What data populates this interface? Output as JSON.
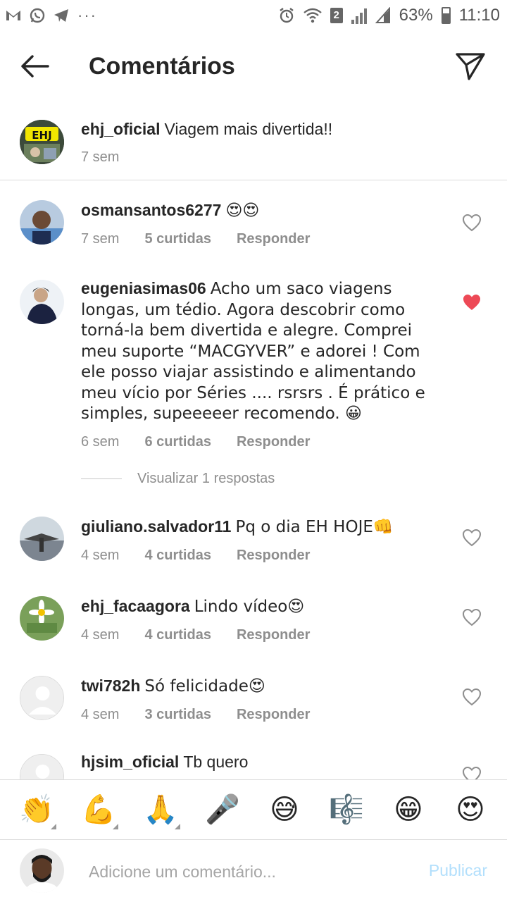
{
  "status_bar": {
    "left_icons": [
      "gmail-icon",
      "whatsapp-icon",
      "telegram-icon",
      "more-dots-icon"
    ],
    "dots": "···",
    "battery": "63%",
    "time": "11:10",
    "sim_badge": "2"
  },
  "header": {
    "title": "Comentários",
    "back_icon": "arrow-left-icon",
    "send_icon": "paper-plane-icon"
  },
  "caption": {
    "username": "ehj_oficial",
    "text": "Viagem mais divertida!!",
    "time": "7 sem",
    "avatar_text": "EHJ"
  },
  "comments": [
    {
      "username": "osmansantos6277",
      "text": "😍😍",
      "time": "7 sem",
      "likes": "5 curtidas",
      "reply": "Responder",
      "liked": false
    },
    {
      "username": "eugeniasimas06",
      "text": "Acho um saco viagens longas, um tédio. Agora descobrir como torná-la bem divertida e alegre. Comprei meu suporte “MACGYVER” e adorei !  Com ele posso viajar assistindo e alimentando meu vício por Séries .... rsrsrs . É prático e simples, supeeeeer recomendo. 😀",
      "time": "6 sem",
      "likes": "6 curtidas",
      "reply": "Responder",
      "liked": true
    },
    {
      "username": "giuliano.salvador11",
      "text": "Pq o dia EH HOJE👊",
      "time": "4 sem",
      "likes": "4 curtidas",
      "reply": "Responder",
      "liked": false
    },
    {
      "username": "ehj_facaagora",
      "text": "Lindo vídeo😍",
      "time": "4 sem",
      "likes": "4 curtidas",
      "reply": "Responder",
      "liked": false
    },
    {
      "username": "twi782h",
      "text": "Só felicidade😍",
      "time": "4 sem",
      "likes": "3 curtidas",
      "reply": "Responder",
      "liked": false
    },
    {
      "username": "hjsim_oficial",
      "text": "Tb quero",
      "liked": false
    }
  ],
  "view_replies": "Visualizar 1 respostas",
  "emoji_bar": [
    {
      "glyph": "👏",
      "name": "clapping-hands-emoji",
      "has_variants": true
    },
    {
      "glyph": "💪",
      "name": "flexed-biceps-emoji",
      "has_variants": true
    },
    {
      "glyph": "🙏",
      "name": "folded-hands-emoji",
      "has_variants": true
    },
    {
      "glyph": "🎤",
      "name": "microphone-emoji",
      "has_variants": false
    },
    {
      "glyph": "😅",
      "name": "grinning-sweat-emoji",
      "has_variants": false
    },
    {
      "glyph": "🎼",
      "name": "musical-score-emoji",
      "has_variants": false
    },
    {
      "glyph": "😁",
      "name": "beaming-face-emoji",
      "has_variants": false
    },
    {
      "glyph": "😍",
      "name": "heart-eyes-emoji",
      "has_variants": false
    }
  ],
  "compose": {
    "placeholder": "Adicione um comentário...",
    "publish": "Publicar"
  },
  "colors": {
    "liked_heart": "#ed4956",
    "publish_disabled": "#b2dffc",
    "meta_gray": "#8e8e8e"
  }
}
